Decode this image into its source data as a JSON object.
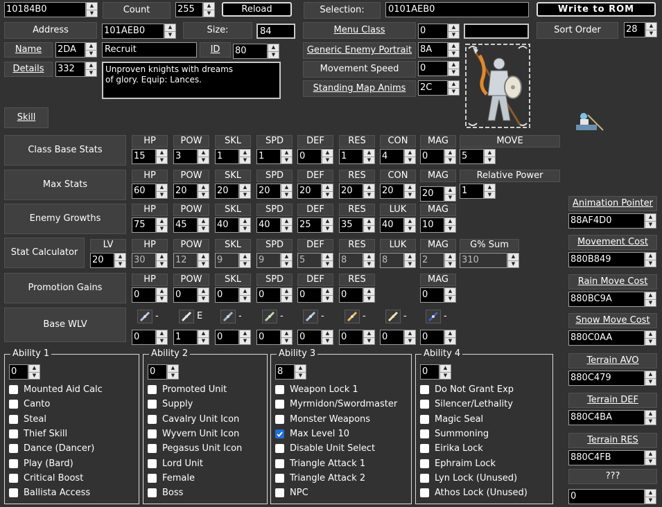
{
  "top": {
    "pointer_value": "10184B0",
    "count_label": "Count",
    "count_value": "255",
    "reload_label": "Reload",
    "selection_label": "Selection:",
    "selection_value": "0101AEB0",
    "write_rom_label": "Write to ROM",
    "address_label": "Address",
    "address_value": "101AEB0",
    "size_label": "Size:",
    "size_value": "84",
    "name_label": "Name",
    "name_id_value": "2DA",
    "name_text": "Recruit",
    "id_label": "ID",
    "id_value": "80",
    "details_label": "Details",
    "details_value": "332",
    "details_text_line1": "Unproven knights with dreams",
    "details_text_line2": "of glory. Equip: Lances.",
    "skill_label": "Skill"
  },
  "class_props": {
    "menu_class_label": "Menu Class",
    "menu_class_value": "0",
    "menu_class_text": "",
    "sort_order_label": "Sort Order",
    "sort_order_value": "28",
    "generic_portrait_label": "Generic Enemy Portrait",
    "generic_portrait_value": "8A",
    "movement_speed_label": "Movement Speed",
    "movement_speed_value": "0",
    "standing_anims_label": "Standing Map Anims",
    "standing_anims_value": "2C"
  },
  "stats": {
    "class_base": {
      "label": "Class Base Stats",
      "headers": [
        "HP",
        "POW",
        "SKL",
        "SPD",
        "DEF",
        "RES",
        "CON",
        "MAG",
        "MOVE"
      ],
      "values": [
        "15",
        "3",
        "1",
        "1",
        "0",
        "1",
        "4",
        "0",
        "5"
      ]
    },
    "max": {
      "label": "Max Stats",
      "headers": [
        "HP",
        "POW",
        "SKL",
        "SPD",
        "DEF",
        "RES",
        "CON",
        "MAG",
        "Relative Power"
      ],
      "values": [
        "60",
        "20",
        "20",
        "20",
        "20",
        "20",
        "20",
        "20",
        "1"
      ]
    },
    "growths": {
      "label": "Enemy Growths",
      "headers": [
        "HP",
        "POW",
        "SKL",
        "SPD",
        "DEF",
        "RES",
        "LUK",
        "MAG"
      ],
      "values": [
        "75",
        "45",
        "40",
        "40",
        "25",
        "35",
        "40",
        "10"
      ]
    },
    "calc": {
      "label": "Stat Calculator",
      "lv_label": "LV",
      "lv_value": "20",
      "headers": [
        "HP",
        "POW",
        "SKL",
        "SPD",
        "DEF",
        "RES",
        "LUK",
        "MAG",
        "G% Sum"
      ],
      "values": [
        "30",
        "12",
        "9",
        "9",
        "5",
        "8",
        "8",
        "2",
        "310"
      ]
    },
    "promo": {
      "label": "Promotion Gains",
      "headers": [
        "HP",
        "POW",
        "SKL",
        "SPD",
        "DEF",
        "RES",
        "MAG"
      ],
      "values": [
        "0",
        "0",
        "0",
        "0",
        "0",
        "0",
        "0"
      ]
    },
    "wlv": {
      "label": "Base WLV",
      "ranks": [
        "-",
        "E",
        "-",
        "-",
        "-",
        "-",
        "-",
        "-"
      ],
      "icons": [
        "sword-icon",
        "lance-icon",
        "axe-icon",
        "bow-icon",
        "anima-icon",
        "light-icon",
        "dark-icon",
        "staff-icon"
      ],
      "values": [
        "0",
        "1",
        "0",
        "0",
        "0",
        "0",
        "0",
        "0"
      ]
    }
  },
  "abilities": [
    {
      "title": "Ability 1",
      "value": "0",
      "items": [
        {
          "label": "Mounted Aid Calc",
          "checked": false
        },
        {
          "label": "Canto",
          "checked": false
        },
        {
          "label": "Steal",
          "checked": false
        },
        {
          "label": "Thief Skill",
          "checked": false
        },
        {
          "label": "Dance (Dancer)",
          "checked": false
        },
        {
          "label": "Play (Bard)",
          "checked": false
        },
        {
          "label": "Critical Boost",
          "checked": false
        },
        {
          "label": "Ballista Access",
          "checked": false
        }
      ]
    },
    {
      "title": "Ability 2",
      "value": "0",
      "items": [
        {
          "label": "Promoted Unit",
          "checked": false
        },
        {
          "label": "Supply",
          "checked": false
        },
        {
          "label": "Cavalry Unit Icon",
          "checked": false
        },
        {
          "label": "Wyvern Unit Icon",
          "checked": false
        },
        {
          "label": "Pegasus Unit Icon",
          "checked": false
        },
        {
          "label": "Lord Unit",
          "checked": false
        },
        {
          "label": "Female",
          "checked": false
        },
        {
          "label": "Boss",
          "checked": false
        }
      ]
    },
    {
      "title": "Ability 3",
      "value": "8",
      "items": [
        {
          "label": "Weapon Lock 1",
          "checked": false
        },
        {
          "label": "Myrmidon/Swordmaster",
          "checked": false
        },
        {
          "label": "Monster Weapons",
          "checked": false
        },
        {
          "label": "Max Level 10",
          "checked": true
        },
        {
          "label": "Disable Unit Select",
          "checked": false
        },
        {
          "label": "Triangle Attack 1",
          "checked": false
        },
        {
          "label": "Triangle Attack 2",
          "checked": false
        },
        {
          "label": "NPC",
          "checked": false
        }
      ]
    },
    {
      "title": "Ability 4",
      "value": "0",
      "items": [
        {
          "label": "Do Not Grant Exp",
          "checked": false
        },
        {
          "label": "Silencer/Lethality",
          "checked": false
        },
        {
          "label": "Magic Seal",
          "checked": false
        },
        {
          "label": "Summoning",
          "checked": false
        },
        {
          "label": "Eirika Lock",
          "checked": false
        },
        {
          "label": "Ephraim Lock",
          "checked": false
        },
        {
          "label": "Lyn Lock (Unused)",
          "checked": false
        },
        {
          "label": "Athos Lock (Unused)",
          "checked": false
        }
      ]
    }
  ],
  "pointers": [
    {
      "label": "Animation Pointer",
      "value": "88AF4D0"
    },
    {
      "label": "Movement Cost",
      "value": "880B849"
    },
    {
      "label": "Rain Move Cost",
      "value": "880BC9A"
    },
    {
      "label": "Snow Move Cost",
      "value": "880C0AA"
    },
    {
      "label": "Terrain AVO",
      "value": "880C479"
    },
    {
      "label": "Terrain DEF",
      "value": "880C4BA"
    },
    {
      "label": "Terrain RES",
      "value": "880C4FB"
    },
    {
      "label": "???",
      "value": "0"
    }
  ]
}
